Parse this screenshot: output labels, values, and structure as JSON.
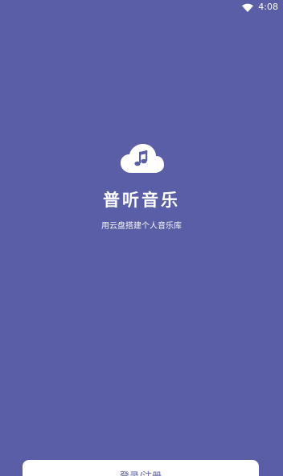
{
  "colors": {
    "background": "#5a5ea6",
    "accent": "#5a5ea6",
    "text": "#ffffff",
    "logo_cloud": "#ffffff",
    "logo_note": "#5a5ea6"
  },
  "status_bar": {
    "time": "4:08",
    "wifi_icon": "wifi-icon"
  },
  "splash": {
    "logo_icon": "cloud-music-icon",
    "app_name": "普听音乐",
    "tagline": "用云盘搭建个人音乐库"
  },
  "actions": {
    "login_register_label": "登录/注册"
  }
}
